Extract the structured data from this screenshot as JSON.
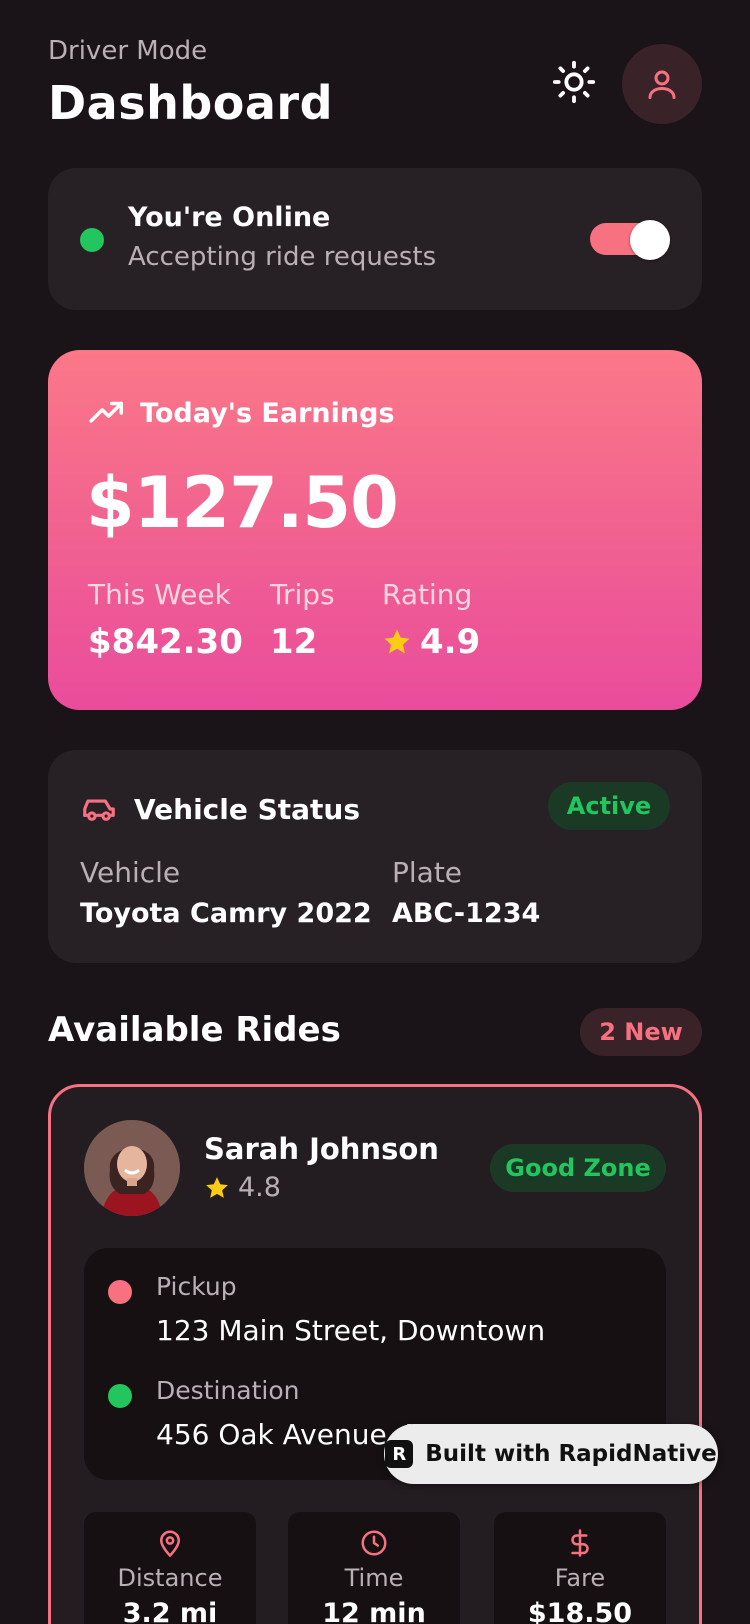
{
  "header": {
    "subtitle": "Driver Mode",
    "title": "Dashboard",
    "theme_icon": "sun-icon",
    "profile_icon": "user-icon"
  },
  "online": {
    "title": "You're Online",
    "subtitle": "Accepting ride requests",
    "toggle_on": true
  },
  "earnings": {
    "title": "Today's Earnings",
    "amount": "$127.50",
    "week_label": "This Week",
    "week_value": "$842.30",
    "trips_label": "Trips",
    "trips_value": "12",
    "rating_label": "Rating",
    "rating_value": "4.9"
  },
  "vehicle": {
    "title": "Vehicle Status",
    "status": "Active",
    "vehicle_label": "Vehicle",
    "vehicle_value": "Toyota Camry 2022",
    "plate_label": "Plate",
    "plate_value": "ABC-1234"
  },
  "rides": {
    "title": "Available Rides",
    "new_badge": "2 New",
    "ride": {
      "name": "Sarah Johnson",
      "rating": "4.8",
      "zone": "Good Zone",
      "pickup_label": "Pickup",
      "pickup_value": "123 Main Street, Downtown",
      "destination_label": "Destination",
      "destination_value": "456 Oak Avenue, M",
      "distance_label": "Distance",
      "distance_value": "3.2 mi",
      "time_label": "Time",
      "time_value": "12 min",
      "fare_label": "Fare",
      "fare_value": "$18.50"
    }
  },
  "built_with": "Built with RapidNative",
  "colors": {
    "background": "#1a1317",
    "card": "#272024",
    "accent": "#f87180",
    "green": "#22c55e",
    "gold": "#facc15"
  }
}
